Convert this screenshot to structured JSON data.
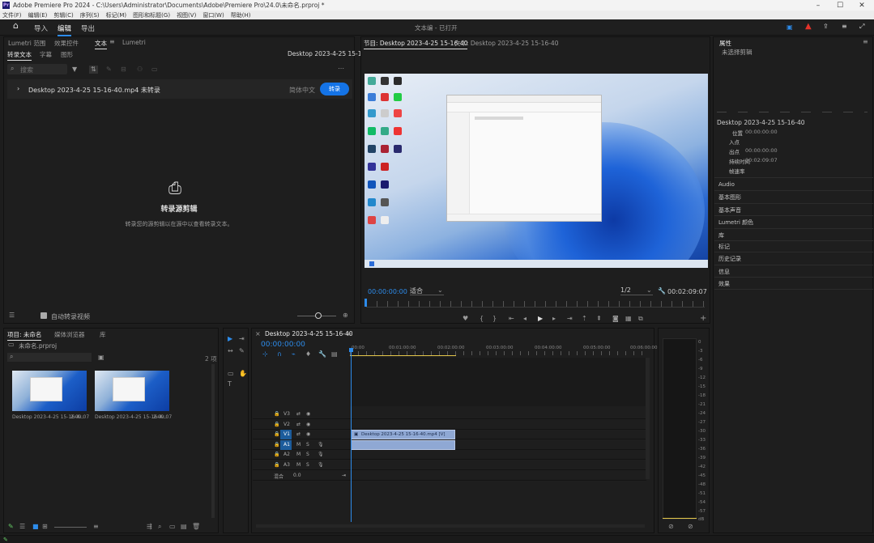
{
  "window": {
    "title": "Adobe Premiere Pro 2024 - C:\\Users\\Administrator\\Documents\\Adobe\\Premiere Pro\\24.0\\未命名.prproj *",
    "controls": [
      "–",
      "☐",
      "✕"
    ]
  },
  "menu": [
    "文件(F)",
    "编辑(E)",
    "剪辑(C)",
    "序列(S)",
    "标记(M)",
    "图形和标题(G)",
    "视图(V)",
    "窗口(W)",
    "帮助(H)"
  ],
  "workspace": {
    "tabs": [
      "导入",
      "编辑",
      "导出"
    ],
    "active": "编辑",
    "center_title": "文本编 - 已打开",
    "colors": {
      "alert": "#e5332a",
      "accent": "#2d8ceb"
    }
  },
  "text_panel": {
    "top_tabs": [
      "Lumetri 范围",
      "效果控件",
      "文本",
      "Lumetri"
    ],
    "sub_tabs": [
      "转录文本",
      "字幕",
      "图形"
    ],
    "active_sub": "转录文本",
    "sequence_name": "Desktop 2023-4-25 15-16-40",
    "search_placeholder": "搜索",
    "clip_row": "Desktop 2023-4-25 15-16-40.mp4 未转录",
    "clip_lang": "简体中文",
    "transcribe_btn": "转录",
    "empty_title": "转录源剪辑",
    "empty_desc": "转录您的源剪辑以在源中以查看转录文本。",
    "auto_transcribe": "自动转录视频"
  },
  "program_monitor": {
    "tab": "节目: Desktop 2023-4-25 15-16-40",
    "tab2": "文本: Desktop 2023-4-25 15-16-40",
    "timecode": "00:00:00:00",
    "fit": "适合",
    "quality": "1/2",
    "duration": "00:02:09:07"
  },
  "right_panel": {
    "tab": "属性",
    "subtitle": "未选择剪辑",
    "clip_name": "Desktop 2023-4-25 15-16-40",
    "rows": [
      {
        "label": "位置",
        "value": "00:00:00:00"
      },
      {
        "label": "入点",
        "value": ""
      },
      {
        "label": "出点",
        "value": "00:00:00:00"
      },
      {
        "label": "持续时间",
        "value": "00:02:09:07"
      },
      {
        "label": "帧速率",
        "value": ""
      }
    ],
    "sections": [
      "Audio",
      "基本图形",
      "基本声音",
      "Lumetri 颜色",
      "库",
      "标记",
      "历史记录",
      "信息",
      "效果"
    ]
  },
  "project_panel": {
    "tabs": [
      "项目: 未命名",
      "媒体浏览器",
      "库"
    ],
    "bin": "未命名.prproj",
    "count": "2 项",
    "items": [
      {
        "name": "Desktop 2023-4-25 15-16-4...",
        "duration": "2:09:07"
      },
      {
        "name": "Desktop 2023-4-25 15-16-4...",
        "duration": "2:09:07"
      }
    ]
  },
  "tools": [
    "▶",
    "⇥",
    "↔",
    "✎",
    "▭",
    "✋",
    "T"
  ],
  "timeline": {
    "tab": "Desktop 2023-4-25 15-16-40",
    "timecode": "00:00:00:00",
    "ruler": [
      "00:00",
      "00:01:00:00",
      "00:02:00:00",
      "00:03:00:00",
      "00:04:00:00",
      "00:05:00:00",
      "00:06:00:00"
    ],
    "tracks": [
      {
        "name": "V3",
        "type": "video"
      },
      {
        "name": "V2",
        "type": "video"
      },
      {
        "name": "V1",
        "type": "video",
        "target": true
      },
      {
        "name": "A1",
        "type": "audio",
        "target": true
      },
      {
        "name": "A2",
        "type": "audio"
      },
      {
        "name": "A3",
        "type": "audio"
      }
    ],
    "mix": "混合",
    "mix_value": "0.0",
    "video_clip": "Desktop 2023-4-25 15-16-40.mp4 [V]"
  },
  "audio_meter": {
    "labels": [
      "0",
      "-3",
      "-6",
      "-9",
      "-12",
      "-15",
      "-18",
      "-21",
      "-24",
      "-27",
      "-30",
      "-33",
      "-36",
      "-39",
      "-42",
      "-45",
      "-48",
      "-51",
      "-54",
      "-57",
      "dB"
    ]
  }
}
